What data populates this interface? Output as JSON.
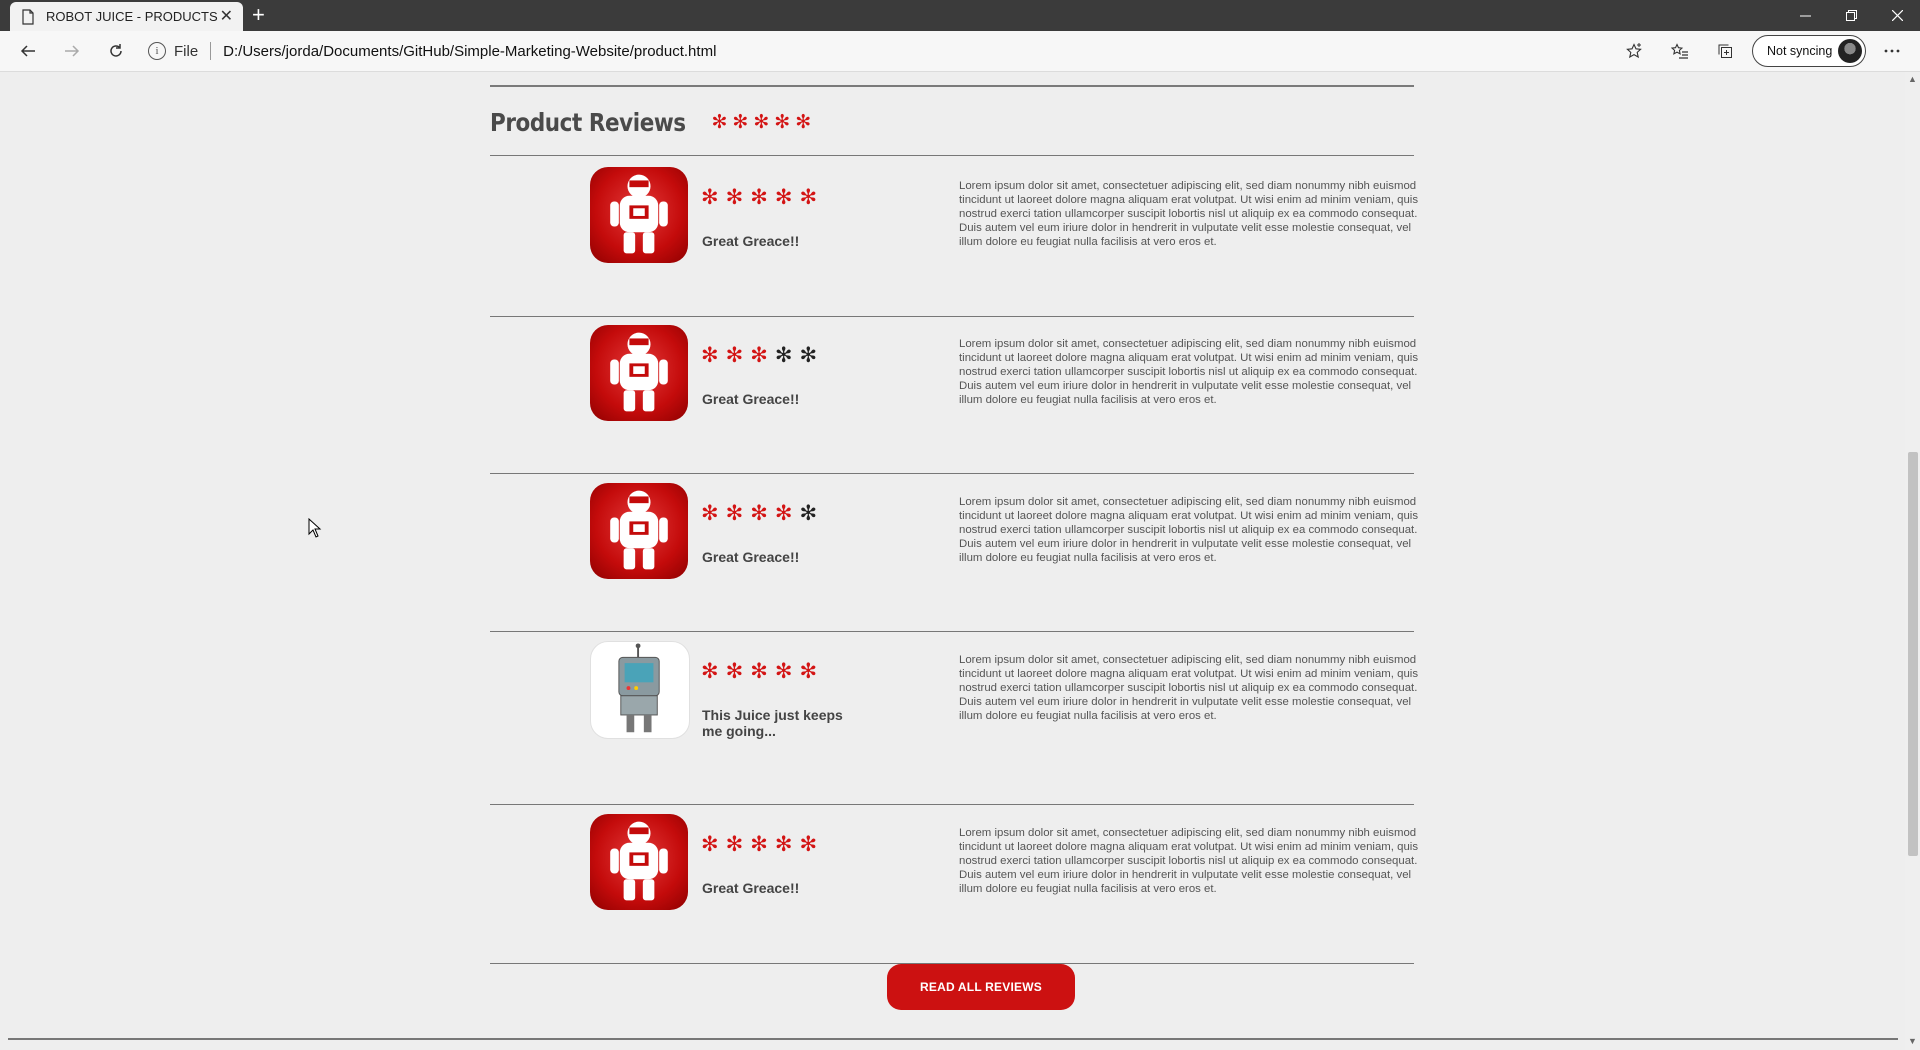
{
  "browser": {
    "tab_title": "ROBOT JUICE - PRODUCTS",
    "tab_close": "✕",
    "new_tab": "+",
    "address_info": "i",
    "address_label": "File",
    "address_url": "D:/Users/jorda/Documents/GitHub/Simple-Marketing-Website/product.html",
    "sync_label": "Not syncing",
    "window_controls": [
      "minimize-icon",
      "restore-icon",
      "close-icon"
    ]
  },
  "page": {
    "section_title": "Product Reviews",
    "section_rating": 5,
    "star_glyph": "✻",
    "reviews": [
      {
        "avatar": "red-robot-icon",
        "rating": 5,
        "name": "Great Greace!!",
        "text": "Lorem ipsum dolor sit amet, consectetuer adipiscing elit, sed diam nonummy nibh euismod tincidunt ut laoreet dolore magna aliquam erat volutpat. Ut wisi enim ad minim veniam, quis nostrud exerci tation ullamcorper suscipit lobortis nisl ut aliquip ex ea commodo consequat. Duis autem vel eum iriure dolor in hendrerit in vulputate velit esse molestie consequat, vel illum dolore eu feugiat nulla facilisis at vero eros et."
      },
      {
        "avatar": "red-robot-icon",
        "rating": 3,
        "name": "Great Greace!!",
        "text": "Lorem ipsum dolor sit amet, consectetuer adipiscing elit, sed diam nonummy nibh euismod tincidunt ut laoreet dolore magna aliquam erat volutpat. Ut wisi enim ad minim veniam, quis nostrud exerci tation ullamcorper suscipit lobortis nisl ut aliquip ex ea commodo consequat. Duis autem vel eum iriure dolor in hendrerit in vulputate velit esse molestie consequat, vel illum dolore eu feugiat nulla facilisis at vero eros et."
      },
      {
        "avatar": "red-robot-icon",
        "rating": 4,
        "name": "Great Greace!!",
        "text": "Lorem ipsum dolor sit amet, consectetuer adipiscing elit, sed diam nonummy nibh euismod tincidunt ut laoreet dolore magna aliquam erat volutpat. Ut wisi enim ad minim veniam, quis nostrud exerci tation ullamcorper suscipit lobortis nisl ut aliquip ex ea commodo consequat. Duis autem vel eum iriure dolor in hendrerit in vulputate velit esse molestie consequat, vel illum dolore eu feugiat nulla facilisis at vero eros et."
      },
      {
        "avatar": "gray-robot-icon",
        "rating": 5,
        "name": "This Juice just keeps me going...",
        "text": "Lorem ipsum dolor sit amet, consectetuer adipiscing elit, sed diam nonummy nibh euismod tincidunt ut laoreet dolore magna aliquam erat volutpat. Ut wisi enim ad minim veniam, quis nostrud exerci tation ullamcorper suscipit lobortis nisl ut aliquip ex ea commodo consequat. Duis autem vel eum iriure dolor in hendrerit in vulputate velit esse molestie consequat, vel illum dolore eu feugiat nulla facilisis at vero eros et."
      },
      {
        "avatar": "red-robot-icon",
        "rating": 5,
        "name": "Great Greace!!",
        "text": "Lorem ipsum dolor sit amet, consectetuer adipiscing elit, sed diam nonummy nibh euismod tincidunt ut laoreet dolore magna aliquam erat volutpat. Ut wisi enim ad minim veniam, quis nostrud exerci tation ullamcorper suscipit lobortis nisl ut aliquip ex ea commodo consequat. Duis autem vel eum iriure dolor in hendrerit in vulputate velit esse molestie consequat, vel illum dolore eu feugiat nulla facilisis at vero eros et."
      }
    ],
    "read_all_label": "READ ALL REVIEWS"
  },
  "colors": {
    "accent_red": "#cc1111",
    "star_red": "#d31414",
    "star_empty": "#222222",
    "page_bg": "#eeeeee"
  }
}
